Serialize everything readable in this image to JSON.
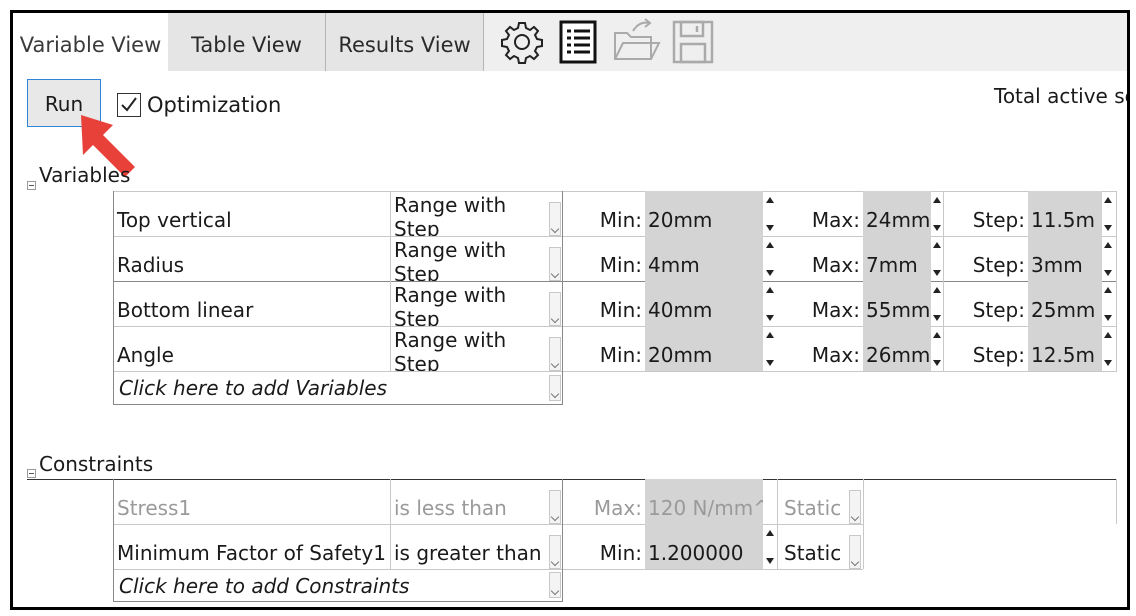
{
  "tabs": [
    {
      "label": "Variable View",
      "active": true
    },
    {
      "label": "Table View",
      "active": false
    },
    {
      "label": "Results View",
      "active": false
    }
  ],
  "toolbar": {
    "icons": [
      "gear-icon",
      "list-icon",
      "folder-arrow-icon",
      "save-icon"
    ]
  },
  "run_label": "Run",
  "optimization": {
    "label": "Optimization",
    "checked": true
  },
  "total_active_label": "Total active sc",
  "variables": {
    "title": "Variables",
    "rows": [
      {
        "name": "Top vertical",
        "type": "Range with Step",
        "min_label": "Min:",
        "min": "20mm",
        "max_label": "Max:",
        "max": "24mm",
        "step_label": "Step:",
        "step": "11.5m"
      },
      {
        "name": "Radius",
        "type": "Range with Step",
        "min_label": "Min:",
        "min": "4mm",
        "max_label": "Max:",
        "max": "7mm",
        "step_label": "Step:",
        "step": "3mm"
      },
      {
        "name": "Bottom linear",
        "type": "Range with Step",
        "min_label": "Min:",
        "min": "40mm",
        "max_label": "Max:",
        "max": "55mm",
        "step_label": "Step:",
        "step": "25mm"
      },
      {
        "name": "Angle",
        "type": "Range with Step",
        "min_label": "Min:",
        "min": "20mm",
        "max_label": "Max:",
        "max": "26mm",
        "step_label": "Step:",
        "step": "12.5m"
      }
    ],
    "add_label": "Click here to add Variables"
  },
  "constraints": {
    "title": "Constraints",
    "rows": [
      {
        "name": "Stress1",
        "condition": "is less than",
        "bound_label": "Max:",
        "bound": "120 N/mm^",
        "study": "Static",
        "disabled": true
      },
      {
        "name": "Minimum Factor of Safety1",
        "condition": "is greater than",
        "bound_label": "Min:",
        "bound": "1.200000",
        "study": "Static",
        "disabled": false
      }
    ],
    "add_label": "Click here to add Constraints"
  },
  "colors": {
    "accent": "#2f84d8",
    "arrow": "#e8413a",
    "cell_gray": "#d4d4d4"
  }
}
